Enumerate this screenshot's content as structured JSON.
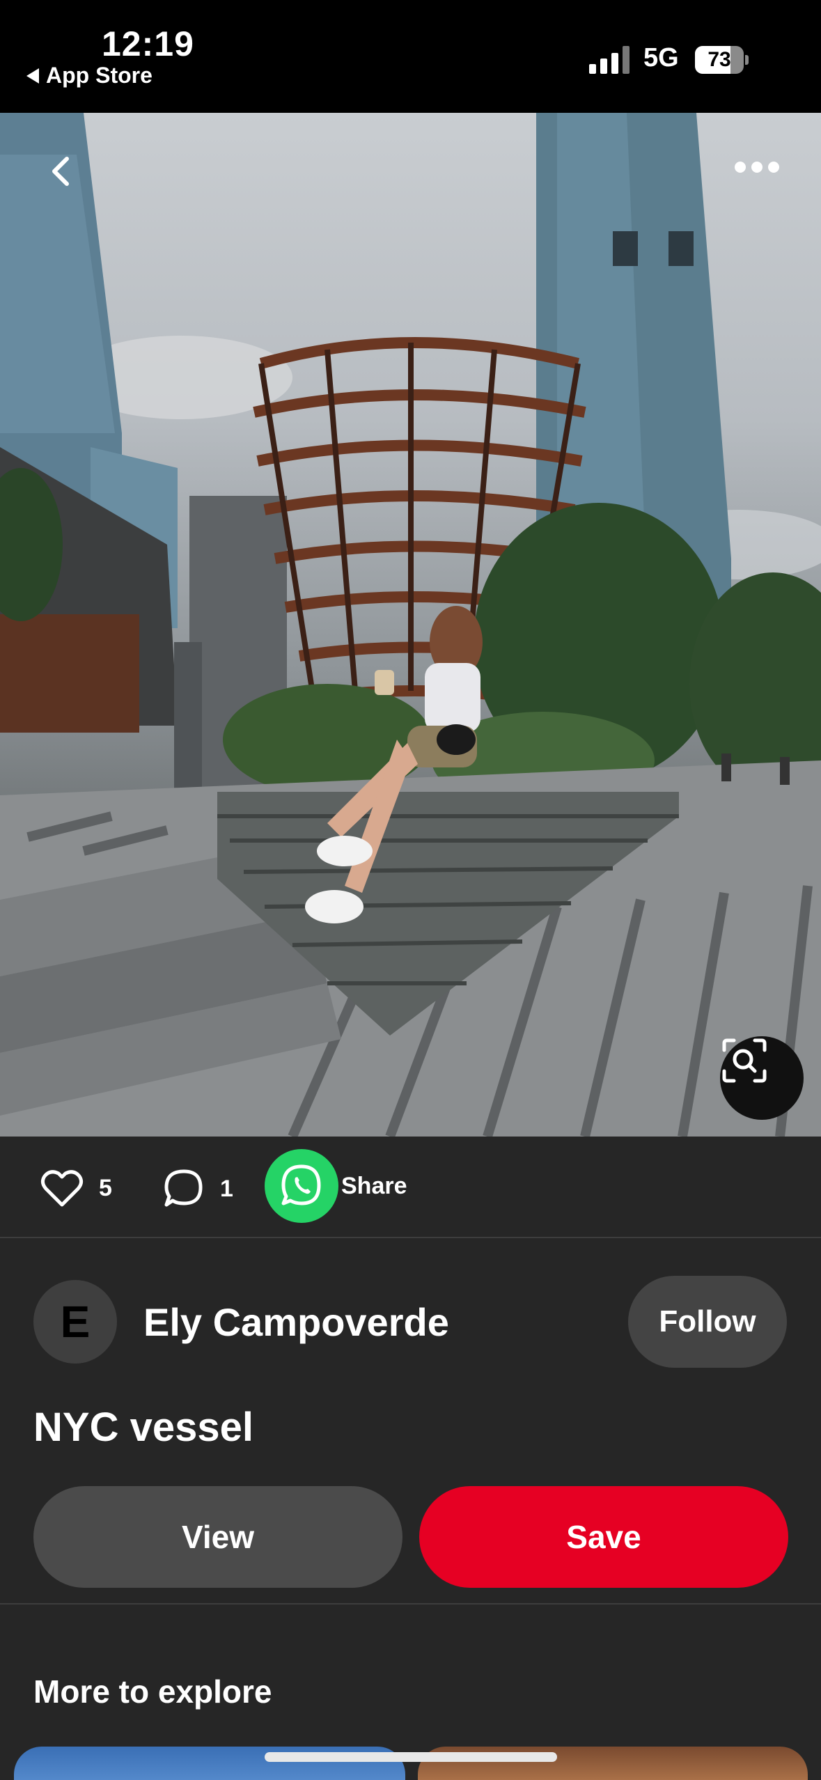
{
  "status_bar": {
    "time": "12:19",
    "back_app_label": "App Store",
    "network": "5G",
    "battery_percent": "73",
    "battery_level": 0.73
  },
  "photo": {
    "back_icon": "chevron-left-icon",
    "more_icon": "more-horizontal-icon",
    "lens_icon": "visual-search-icon"
  },
  "actions": {
    "likes_count": "5",
    "comments_count": "1",
    "share_label": "Share",
    "share_icon": "whatsapp-icon",
    "share_color": "#25D366"
  },
  "author": {
    "avatar_initial": "E",
    "name": "Ely Campoverde",
    "follow_label": "Follow"
  },
  "pin": {
    "title": "NYC vessel"
  },
  "buttons": {
    "view_label": "View",
    "save_label": "Save",
    "save_color": "#E60023"
  },
  "explore": {
    "heading": "More to explore"
  }
}
